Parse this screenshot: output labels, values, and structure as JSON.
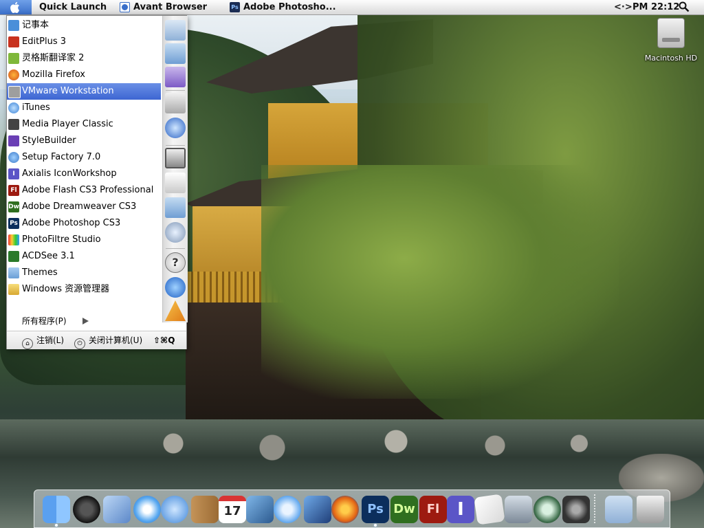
{
  "menubar": {
    "quick_launch": "Quick Launch",
    "tasks": [
      "Avant Browser",
      "Adobe Photosho..."
    ],
    "net_indicator": "<·>",
    "clock": "PM 22:12"
  },
  "desktop": {
    "icons": [
      {
        "label": "Macintosh HD",
        "icon": "hard-drive-icon"
      }
    ]
  },
  "start_menu": {
    "programs": [
      {
        "label": "记事本",
        "icon": "notepad-icon"
      },
      {
        "label": "EditPlus 3",
        "icon": "editplus-icon"
      },
      {
        "label": "灵格斯翻译家 2",
        "icon": "lingoes-icon"
      },
      {
        "label": "Mozilla Firefox",
        "icon": "firefox-icon"
      },
      {
        "label": "VMware Workstation",
        "icon": "vmware-icon",
        "selected": true
      },
      {
        "label": "iTunes",
        "icon": "itunes-icon"
      },
      {
        "label": "Media Player Classic",
        "icon": "media-player-icon"
      },
      {
        "label": "StyleBuilder",
        "icon": "stylebuilder-icon"
      },
      {
        "label": "Setup Factory 7.0",
        "icon": "setup-factory-icon"
      },
      {
        "label": "Axialis IconWorkshop",
        "icon": "iconworkshop-icon"
      },
      {
        "label": "Adobe Flash CS3 Professional",
        "icon": "flash-icon"
      },
      {
        "label": "Adobe Dreamweaver CS3",
        "icon": "dreamweaver-icon"
      },
      {
        "label": "Adobe Photoshop CS3",
        "icon": "photoshop-icon"
      },
      {
        "label": "PhotoFiltre Studio",
        "icon": "photofiltre-icon"
      },
      {
        "label": "ACDSee 3.1",
        "icon": "acdsee-icon"
      },
      {
        "label": "Themes",
        "icon": "folder-icon"
      },
      {
        "label": "Windows 资源管理器",
        "icon": "explorer-icon"
      }
    ],
    "all_programs": "所有程序(P)",
    "logoff": "注销(L)",
    "shutdown": "关闭计算机(U)",
    "quit_shortcut": "⇧⌘Q",
    "places": [
      "documents-icon",
      "folder-forward-icon",
      "music-folder-icon",
      "drive-icon",
      "network-globe-icon",
      "control-panel-icon",
      "printer-icon",
      "folder-arrow-icon",
      "globe-icon",
      "help-icon",
      "search-icon",
      "run-icon"
    ]
  },
  "dock": {
    "items": [
      "finder-icon",
      "dashboard-icon",
      "mail-icon",
      "safari-icon",
      "ichat-icon",
      "address-book-icon",
      "ical-icon",
      "iphoto-icon",
      "itunes-icon",
      "imovie-icon",
      "firefox-icon",
      "photoshop-icon",
      "dreamweaver-icon",
      "flash-icon",
      "iconworkshop-icon",
      "textedit-icon",
      "expose-icon",
      "time-machine-icon",
      "system-preferences-icon",
      "documents-folder-icon",
      "trash-icon"
    ],
    "labels": {
      "ps": "Ps",
      "dw": "Dw",
      "fl": "Fl",
      "ical_day": "17"
    },
    "colors": {
      "photoshop": "#0c2e5c",
      "dreamweaver": "#2f6e1f",
      "flash": "#9d1a10"
    }
  }
}
